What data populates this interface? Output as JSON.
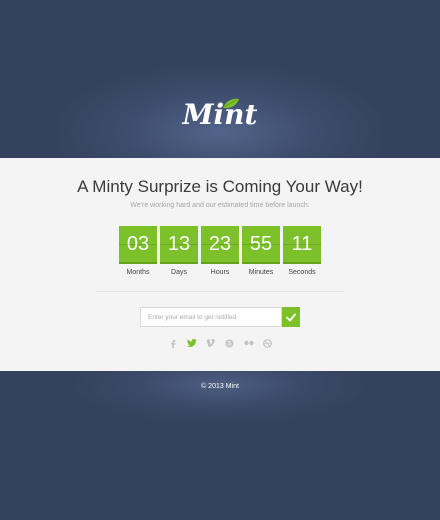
{
  "brand": {
    "logo_text": "Mint",
    "accent": "#7cc12a"
  },
  "hero": {
    "headline": "A Minty Surprize is Coming Your Way!",
    "subtext": "We're working hard and our estimated time before launch:"
  },
  "countdown": [
    {
      "value": "03",
      "label": "Months"
    },
    {
      "value": "13",
      "label": "Days"
    },
    {
      "value": "23",
      "label": "Hours"
    },
    {
      "value": "55",
      "label": "Minutes"
    },
    {
      "value": "11",
      "label": "Seconds"
    }
  ],
  "signup": {
    "placeholder": "Enter your email to get notified",
    "submit_icon": "checkmark-icon"
  },
  "social": [
    "facebook-icon",
    "twitter-icon",
    "vimeo-icon",
    "skype-icon",
    "flickr-icon",
    "dribbble-icon"
  ],
  "footer": {
    "copyright": "© 2013 Mint"
  }
}
